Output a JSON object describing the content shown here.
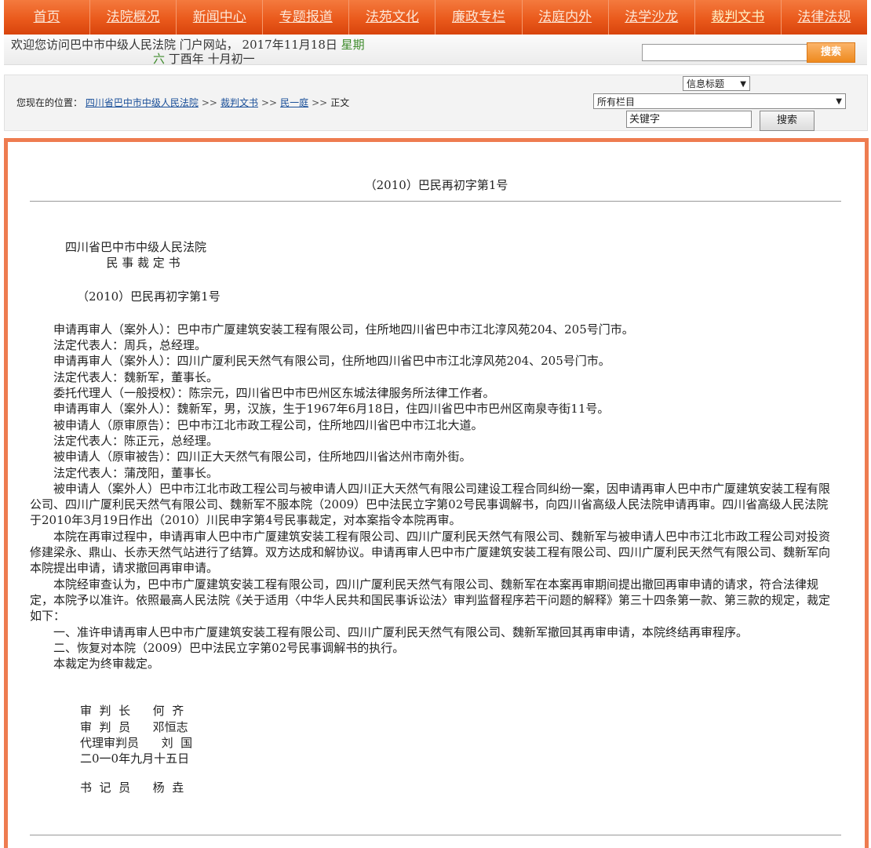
{
  "nav": {
    "items": [
      "首页",
      "法院概况",
      "新闻中心",
      "专题报道",
      "法苑文化",
      "廉政专栏",
      "法庭内外",
      "法学沙龙",
      "裁判文书",
      "法律法规"
    ],
    "colors": {
      "bar": "#e85a20",
      "text": "#fde6d6"
    }
  },
  "welcome": {
    "line1": "欢迎您访问巴中市中级人民法院 门户网站，  2017年11月18日",
    "weekday_part1": "星期",
    "weekday_part2": "六",
    "lunar": "丁酉年 十月初一",
    "search_button": "搜索"
  },
  "location": {
    "prefix": "您现在的位置：",
    "crumbs": [
      "四川省巴中市中级人民法院",
      "裁判文书",
      "民一庭"
    ],
    "separator": ">>",
    "current": "正文"
  },
  "search": {
    "title_option": "信息标题",
    "column_option": "所有栏目",
    "keyword_value": "关键字",
    "button": "搜索"
  },
  "document": {
    "header_case_no": "（2010）巴民再初字第1号",
    "court": "四川省巴中市中级人民法院",
    "doc_type": "民 事 裁 定 书",
    "case_no": "（2010）巴民再初字第1号",
    "parties": [
      "申请再审人（案外人）：巴中市广厦建筑安装工程有限公司，住所地四川省巴中市江北淳风苑204、205号门市。",
      "法定代表人：周兵，总经理。",
      "申请再审人（案外人）：四川广厦利民天然气有限公司，住所地四川省巴中市江北淳风苑204、205号门市。",
      "法定代表人：魏新军，董事长。",
      "委托代理人（一般授权）：陈宗元，四川省巴中市巴州区东城法律服务所法律工作者。",
      "申请再审人（案外人）：魏新军，男，汉族，生于1967年6月18日，住四川省巴中市巴州区南泉寺街11号。",
      "被申请人（原审原告）：巴中市江北市政工程公司，住所地四川省巴中市江北大道。",
      "法定代表人：陈正元，总经理。",
      "被申请人（原审被告）：四川正大天然气有限公司，住所地四川省达州市南外街。",
      "法定代表人：蒲茂阳，董事长。"
    ],
    "paragraphs": [
      "被申请人（案外人）巴中市江北市政工程公司与被申请人四川正大天然气有限公司建设工程合同纠纷一案，因申请再审人巴中市广厦建筑安装工程有限公司、四川广厦利民天然气有限公司、魏新军不服本院（2009）巴中法民立字第02号民事调解书，向四川省高级人民法院申请再审。四川省高级人民法院于2010年3月19日作出（2010）川民申字第4号民事裁定，对本案指令本院再审。",
      "本院在再审过程中，申请再审人巴中市广厦建筑安装工程有限公司、四川广厦利民天然气有限公司、魏新军与被申请人巴中市江北市政工程公司对投资修建梁永、鼎山、长赤天然气站进行了结算。双方达成和解协议。申请再审人巴中市广厦建筑安装工程有限公司、四川广厦利民天然气有限公司、魏新军向本院提出申请，请求撤回再审申请。",
      "本院经审查认为，巴中市广厦建筑安装工程有限公司，四川广厦利民天然气有限公司、魏新军在本案再审期间提出撤回再审申请的请求，符合法律规定，本院予以准许。依照最高人民法院《关于适用〈中华人民共和国民事诉讼法〉审判监督程序若干问题的解释》第三十四条第一款、第三款的规定，裁定如下：",
      "一、准许申请再审人巴中市广厦建筑安装工程有限公司、四川广厦利民天然气有限公司、魏新军撤回其再审申请，本院终结再审程序。",
      "二、恢复对本院（2009）巴中法民立字第02号民事调解书的执行。",
      "本裁定为终审裁定。"
    ],
    "signatures": [
      "审  判  长      何  齐",
      "审  判  员      邓恒志",
      "代理审判员      刘  国",
      "二0一0年九月十五日"
    ],
    "clerk": "书  记  员      杨  垚"
  }
}
